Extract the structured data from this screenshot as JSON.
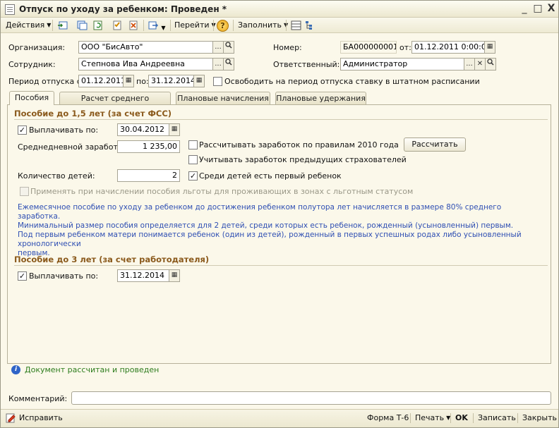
{
  "window": {
    "title": "Отпуск по уходу за ребенком: Проведен *",
    "controls": [
      "_",
      "□",
      "X"
    ]
  },
  "toolbar": {
    "actions_label": "Действия",
    "goto_label": "Перейти",
    "fill_label": "Заполнить",
    "help_symbol": "?"
  },
  "header": {
    "org_label": "Организация:",
    "org_value": "ООО \"БисАвто\"",
    "number_label": "Номер:",
    "number_value": "БА000000001",
    "from_label": "от:",
    "date_value": "01.12.2011  0:00:00",
    "employee_label": "Сотрудник:",
    "employee_value": "Степнова Ива Андреевна",
    "responsible_label": "Ответственный:",
    "responsible_value": "Администратор",
    "period_label": "Период отпуска с:",
    "period_from": "01.12.2011",
    "period_to_label": "по:",
    "period_to": "31.12.2014",
    "release_rate_label": "Освободить на период отпуска ставку в штатном расписании",
    "release_rate_checked": false,
    "ellipsis": "...",
    "search_symbol": "🔍",
    "clear_symbol": "✕"
  },
  "tabs": [
    {
      "label": "Пособия",
      "active": true
    },
    {
      "label": "Расчет среднего заработка",
      "active": false
    },
    {
      "label": "Плановые начисления",
      "active": false
    },
    {
      "label": "Плановые удержания",
      "active": false
    }
  ],
  "benefit_15": {
    "title": "Пособие до 1,5 лет (за счет ФСС)",
    "pay_until_label": "Выплачивать по:",
    "pay_until_checked": true,
    "pay_until_value": "30.04.2012",
    "avg_earnings_label": "Среднедневной заработок:",
    "avg_earnings_value": "1 235,00",
    "calc_2010_label": "Рассчитывать заработок по правилам 2010 года",
    "calc_2010_checked": false,
    "prev_employers_label": "Учитывать заработок предыдущих страхователей",
    "prev_employers_checked": false,
    "calc_button": "Рассчитать",
    "children_count_label": "Количество детей:",
    "children_count_value": "2",
    "first_child_label": "Среди детей есть первый ребенок",
    "first_child_checked": true,
    "privilege_label": "Применять при начислении пособия льготы для проживающих в зонах с льготным статусом",
    "privilege_checked": false,
    "info_line1": "Ежемесячное пособие по уходу за ребенком до достижения ребенком полутора лет начисляется в размере 80% среднего заработка.",
    "info_line2": "Минимальный размер пособия определяется для 2 детей, среди которых есть ребенок, рожденный (усыновленный) первым.",
    "info_line3": "Под первым ребенком матери понимается ребенок (один из детей), рожденный в первых успешных родах либо усыновленный хронологически",
    "info_line4": "первым."
  },
  "benefit_3": {
    "title": "Пособие до 3 лет (за счет работодателя)",
    "pay_until_label": "Выплачивать по:",
    "pay_until_checked": true,
    "pay_until_value": "31.12.2014"
  },
  "status": {
    "info_icon": "i",
    "message": "Документ рассчитан и проведен",
    "message_color": "#2e7d1e"
  },
  "comment": {
    "label": "Комментарий:",
    "value": ""
  },
  "bottom": {
    "fix_label": "Исправить",
    "form_label": "Форма Т-6",
    "print_label": "Печать",
    "ok_label": "OK",
    "save_label": "Записать",
    "close_label": "Закрыть"
  }
}
